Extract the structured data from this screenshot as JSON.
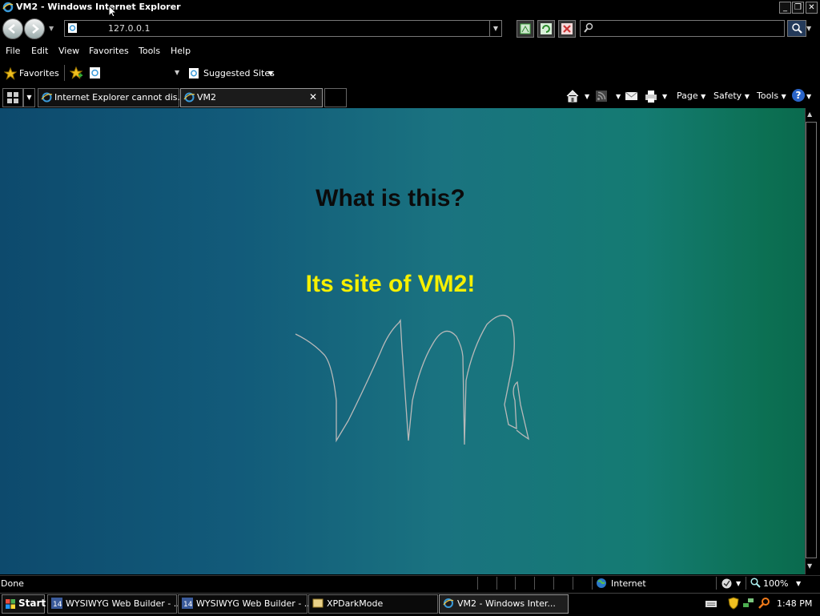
{
  "window": {
    "title": "VM2 - Windows Internet Explorer"
  },
  "nav": {
    "address": "127.0.0.1"
  },
  "menu": {
    "items": [
      "File",
      "Edit",
      "View",
      "Favorites",
      "Tools",
      "Help"
    ]
  },
  "favorites_bar": {
    "favorites_label": "Favorites",
    "suggested_sites_label": "Suggested Sites"
  },
  "tabs": [
    {
      "label": "Internet Explorer cannot dis..."
    },
    {
      "label": "VM2"
    }
  ],
  "command_bar": {
    "page": "Page",
    "safety": "Safety",
    "tools": "Tools"
  },
  "page": {
    "heading": "What is this?",
    "tagline": "Its site of VM2!",
    "heading_color": "#0b0b0b",
    "tagline_color": "#f6f000"
  },
  "status": {
    "text": "Done",
    "zone": "Internet",
    "zoom": "100%"
  },
  "taskbar": {
    "start": "Start",
    "buttons": [
      {
        "label": "WYSIWYG Web Builder - ..."
      },
      {
        "label": "WYSIWYG Web Builder - ..."
      },
      {
        "label": "XPDarkMode"
      },
      {
        "label": "VM2 - Windows Inter..."
      }
    ],
    "clock": "1:48 PM"
  }
}
